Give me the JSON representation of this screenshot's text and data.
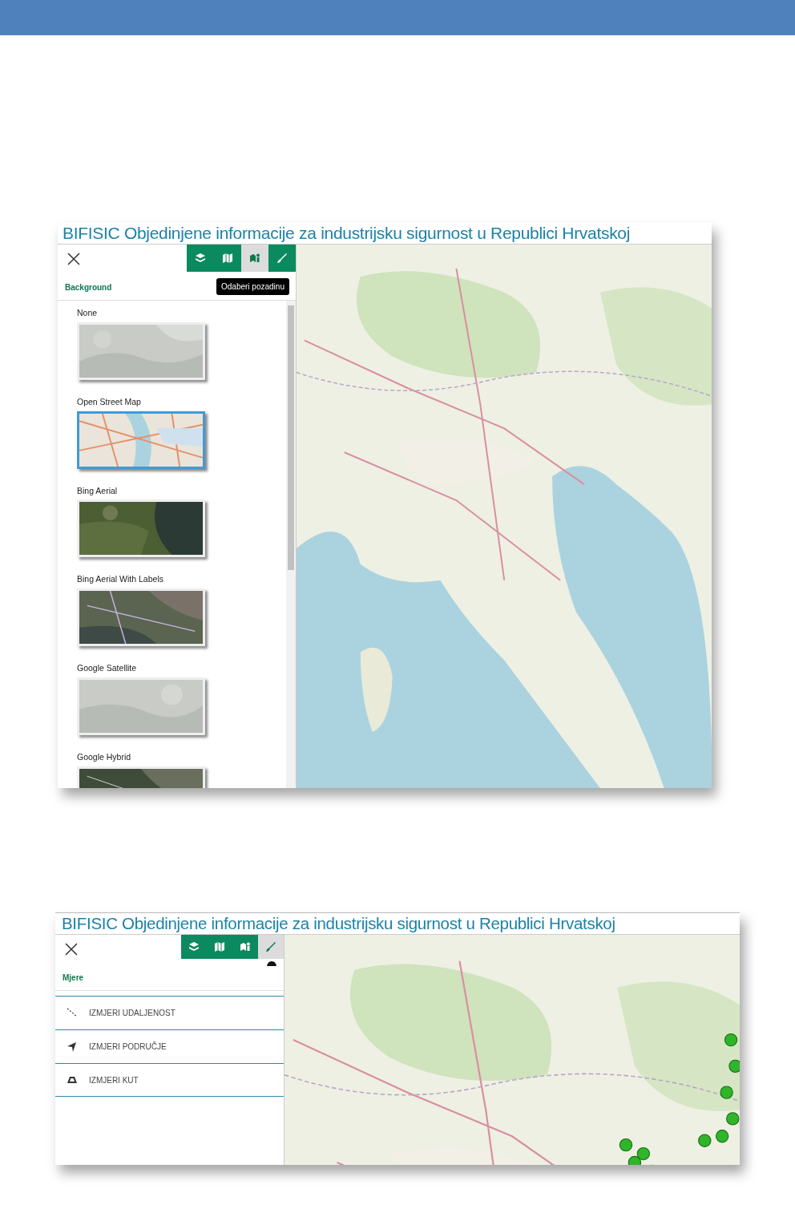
{
  "screens": [
    {
      "title": "BIFISIC Objedinjene informacije za industrijsku sigurnost u Republici Hrvatskoj",
      "toolbar": [
        {
          "kind": "layers",
          "selected": false
        },
        {
          "kind": "map",
          "selected": false
        },
        {
          "kind": "map-pin",
          "selected": true
        },
        {
          "kind": "brush",
          "selected": false
        }
      ],
      "tooltip": "Odaberi pozadinu",
      "panel": {
        "heading": "Background",
        "kind": "backgrounds",
        "items": [
          {
            "label": "None",
            "selected": false
          },
          {
            "label": "Open Street Map",
            "selected": true
          },
          {
            "label": "Bing Aerial",
            "selected": false
          },
          {
            "label": "Bing Aerial With Labels",
            "selected": false
          },
          {
            "label": "Google Satellite",
            "selected": false
          },
          {
            "label": "Google Hybrid",
            "selected": false
          }
        ]
      }
    },
    {
      "title": "BIFISIC Objedinjene informacije za industrijsku sigurnost u Republici Hrvatskoj",
      "toolbar": [
        {
          "kind": "layers",
          "selected": false
        },
        {
          "kind": "map",
          "selected": false
        },
        {
          "kind": "map-pin",
          "selected": false
        },
        {
          "kind": "brush",
          "selected": true
        }
      ],
      "panel": {
        "heading": "Mjere",
        "kind": "tools",
        "items": [
          {
            "label": "IZMJERI UDALJENOST",
            "kind": "distance"
          },
          {
            "label": "IZMJERI PODRUČJE",
            "kind": "area"
          },
          {
            "label": "IZMJERI KUT",
            "kind": "angle"
          }
        ]
      }
    }
  ]
}
